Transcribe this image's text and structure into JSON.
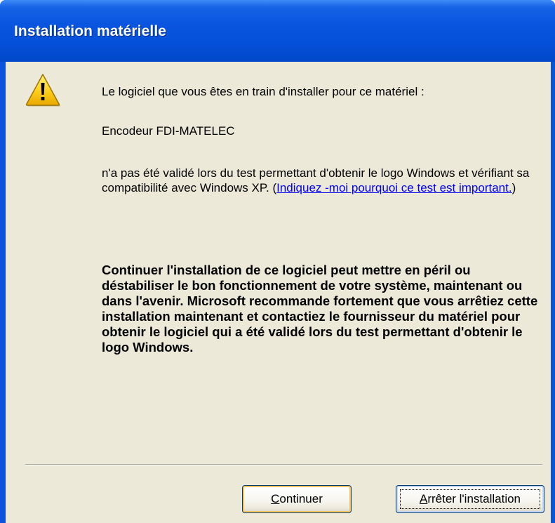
{
  "window": {
    "title": "Installation matérielle"
  },
  "icon": {
    "name": "warning-icon",
    "color": "#ffd21f"
  },
  "message": {
    "line1": "Le logiciel que vous êtes en train d'installer pour ce matériel :",
    "device": "Encodeur FDI-MATELEC",
    "not_validated_prefix": "n'a pas été validé lors du test permettant d'obtenir le logo Windows et vérifiant sa compatibilité avec Windows XP. (",
    "link_text": "Indiquez -moi pourquoi ce test est important.",
    "not_validated_suffix": ")",
    "warning": "Continuer l'installation de ce logiciel peut mettre en péril ou déstabiliser le bon fonctionnement de votre système, maintenant ou dans l'avenir. Microsoft recommande fortement que vous arrêtiez cette installation maintenant et contactiez le fournisseur du matériel pour obtenir le logiciel qui a été validé lors du test permettant d'obtenir le logo Windows."
  },
  "buttons": {
    "continue": {
      "accel": "C",
      "rest": "ontinuer"
    },
    "stop": {
      "accel": "A",
      "rest": "rrêter l'installation"
    }
  },
  "colors": {
    "titlebar": "#0a55df",
    "client_bg": "#ece9d8",
    "link": "#0000ee"
  }
}
